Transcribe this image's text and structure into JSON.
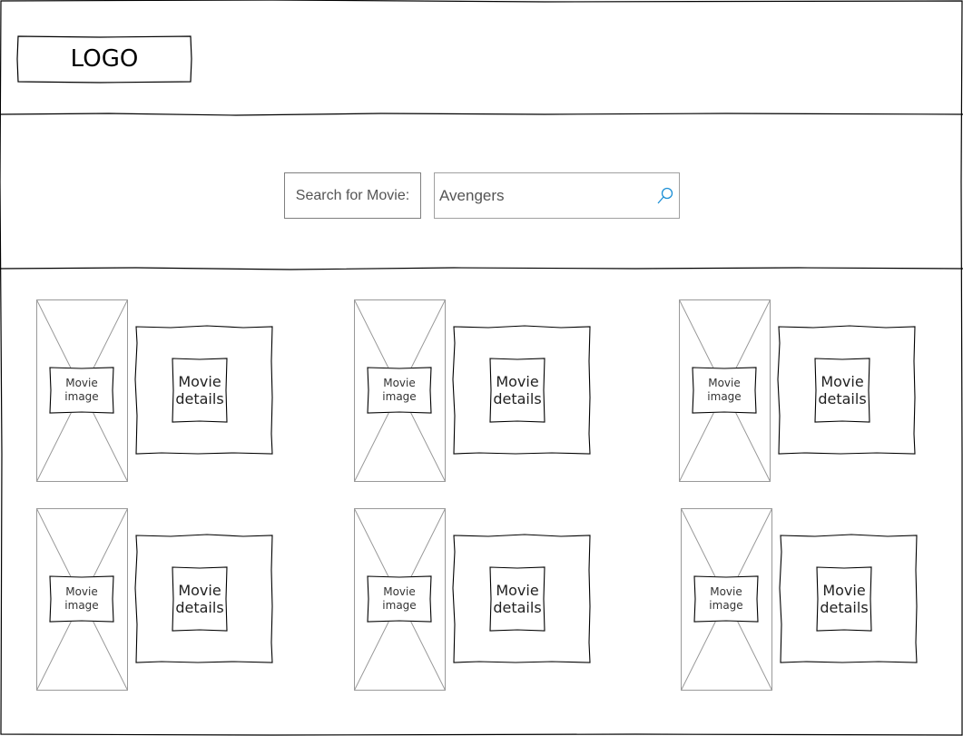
{
  "header": {
    "logo_text": "LOGO"
  },
  "search": {
    "label": "Search for Movie:",
    "value": "Avengers",
    "icon": "search-icon"
  },
  "movies": [
    {
      "image_label": "Movie image",
      "details_label": "Movie details"
    },
    {
      "image_label": "Movie image",
      "details_label": "Movie details"
    },
    {
      "image_label": "Movie image",
      "details_label": "Movie details"
    },
    {
      "image_label": "Movie image",
      "details_label": "Movie details"
    },
    {
      "image_label": "Movie image",
      "details_label": "Movie details"
    },
    {
      "image_label": "Movie image",
      "details_label": "Movie details"
    }
  ],
  "colors": {
    "sketch_line": "#000000",
    "placeholder_line": "#999999",
    "icon_accent": "#1e90d6"
  }
}
